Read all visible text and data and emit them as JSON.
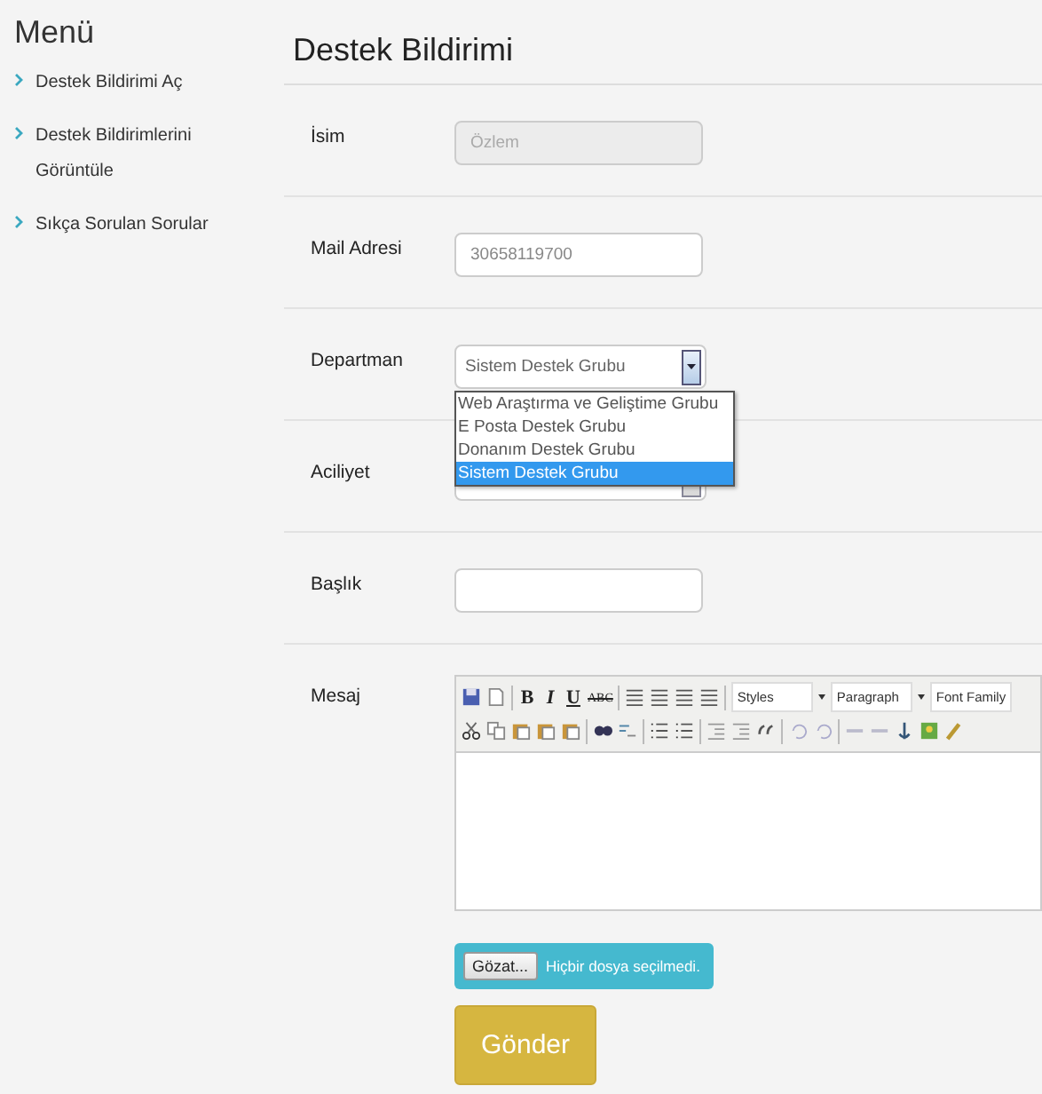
{
  "sidebar": {
    "title": "Menü",
    "items": [
      {
        "label": "Destek Bildirimi Aç"
      },
      {
        "label": "Destek Bildirimlerini Görüntüle"
      },
      {
        "label": "Sıkça Sorulan Sorular"
      }
    ]
  },
  "page_title": "Destek Bildirimi",
  "fields": [
    {
      "kind": "text",
      "label": "İsim",
      "value": "Özlem",
      "disabled": true
    },
    {
      "kind": "text",
      "label": "Mail Adresi",
      "value": "30658119700",
      "disabled": false
    },
    {
      "kind": "select",
      "label": "Departman",
      "value": "Sistem Destek Grubu",
      "expanded": true,
      "options": [
        {
          "label": "Web Araştırma ve Geliştime Grubu",
          "selected": false
        },
        {
          "label": "E Posta Destek Grubu",
          "selected": false
        },
        {
          "label": "Donanım Destek Grubu",
          "selected": false
        },
        {
          "label": "Sistem Destek Grubu",
          "selected": true
        }
      ]
    },
    {
      "kind": "select",
      "label": "Aciliyet"
    },
    {
      "kind": "text",
      "label": "Başlık",
      "disabled": false
    },
    {
      "kind": "editor",
      "label": "Mesaj",
      "format_buttons": [
        "B",
        "I",
        "U",
        "ABC"
      ],
      "dropdowns": [
        "Styles",
        "Paragraph",
        "Font Family"
      ]
    }
  ],
  "file_input": {
    "button": "Gözat...",
    "status": "Hiçbir dosya seçilmedi."
  },
  "submit": "Gönder"
}
